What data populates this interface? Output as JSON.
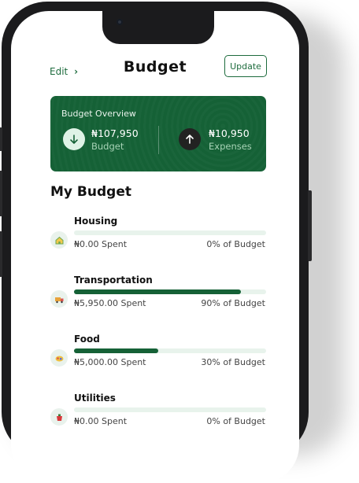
{
  "header": {
    "edit_label": "Edit",
    "edit_chevron": "›",
    "title": "Budget",
    "update_label": "Update"
  },
  "overview": {
    "title": "Budget Overview",
    "budget_amount": "₦107,950",
    "budget_label": "Budget",
    "expenses_amount": "₦10,950",
    "expenses_label": "Expenses",
    "budget_icon": "arrow-down-icon",
    "expenses_icon": "arrow-up-icon"
  },
  "section_title": "My Budget",
  "categories": [
    {
      "name": "Housing",
      "icon": "house-icon",
      "spent": "₦0.00 Spent",
      "percent_label": "0% of Budget",
      "fill": 0
    },
    {
      "name": "Transportation",
      "icon": "truck-icon",
      "spent": "₦5,950.00 Spent",
      "percent_label": "90% of Budget",
      "fill": 0.87
    },
    {
      "name": "Food",
      "icon": "food-icon",
      "spent": "₦5,000.00 Spent",
      "percent_label": "30% of Budget",
      "fill": 0.44
    },
    {
      "name": "Utilities",
      "icon": "utilities-icon",
      "spent": "₦0.00 Spent",
      "percent_label": "0% of Budget",
      "fill": 0
    }
  ],
  "colors": {
    "brand": "#156136",
    "track": "#e8f3ec"
  }
}
